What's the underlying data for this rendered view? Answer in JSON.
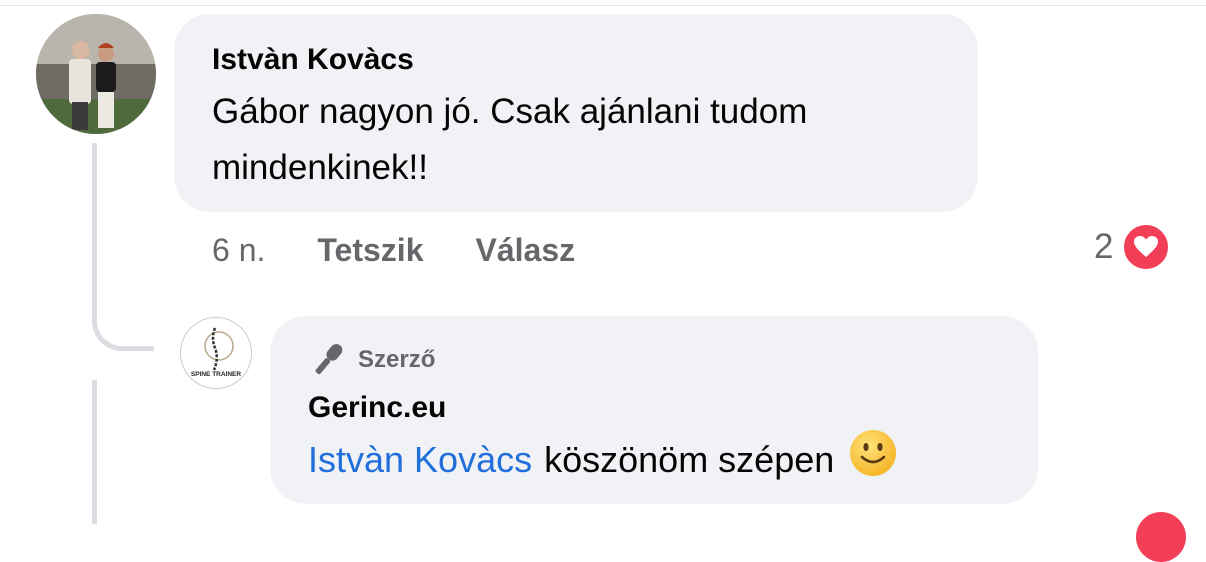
{
  "comment": {
    "author": "Istvàn Kovàcs",
    "text_line1": "Gábor nagyon jó. Csak ajánlani tudom",
    "text_line2": "mindenkinek!!",
    "time": "6 n.",
    "like_label": "Tetszik",
    "reply_label": "Válasz",
    "reaction_count": "2",
    "reaction_icon": "heart-icon"
  },
  "reply": {
    "badge_icon": "microphone-icon",
    "badge_label": "Szerző",
    "author": "Gerinc.eu",
    "mention": "Istvàn Kovàcs",
    "text": "köszönöm szépen",
    "emoji": "slightly-smiling-face-icon",
    "avatar_text": "SPINE TRAINER"
  },
  "colors": {
    "bubble": "#f0f2f5",
    "mention": "#216fdb",
    "heart": "#f33e58",
    "muted": "#65676b"
  }
}
